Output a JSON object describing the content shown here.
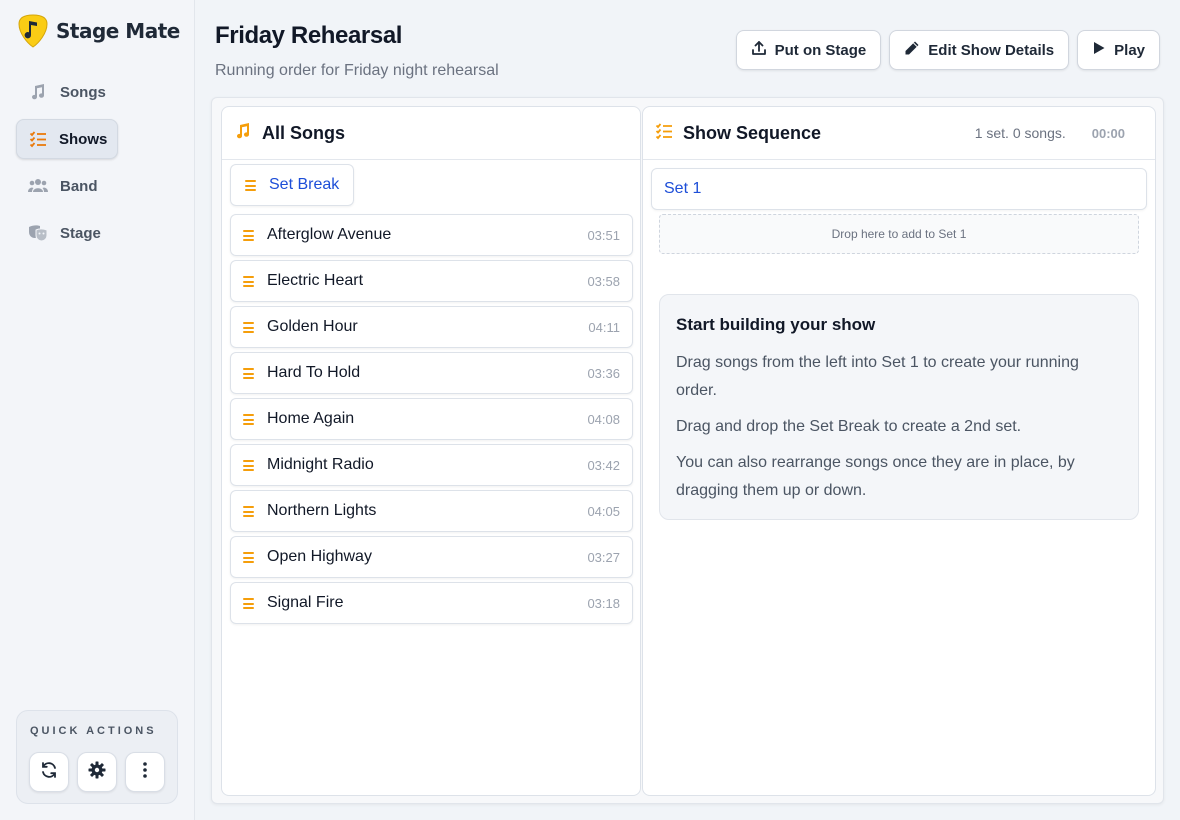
{
  "app": {
    "name": "Stage Mate"
  },
  "sidebar": {
    "items": [
      {
        "label": "Songs",
        "icon": "music-note-icon"
      },
      {
        "label": "Shows",
        "icon": "list-check-icon",
        "active": true
      },
      {
        "label": "Band",
        "icon": "users-icon"
      },
      {
        "label": "Stage",
        "icon": "masks-icon"
      }
    ],
    "quick_actions": {
      "title": "QUICK ACTIONS",
      "buttons": [
        "refresh-icon",
        "gear-icon",
        "more-vertical-icon"
      ]
    }
  },
  "header": {
    "title": "Friday Rehearsal",
    "subtitle": "Running order for Friday night rehearsal",
    "actions": {
      "put_on_stage": "Put on Stage",
      "edit_details": "Edit Show Details",
      "play": "Play"
    }
  },
  "all_songs": {
    "title": "All Songs",
    "set_break_label": "Set Break",
    "songs": [
      {
        "title": "Afterglow Avenue",
        "duration": "03:51"
      },
      {
        "title": "Electric Heart",
        "duration": "03:58"
      },
      {
        "title": "Golden Hour",
        "duration": "04:11"
      },
      {
        "title": "Hard To Hold",
        "duration": "03:36"
      },
      {
        "title": "Home Again",
        "duration": "04:08"
      },
      {
        "title": "Midnight Radio",
        "duration": "03:42"
      },
      {
        "title": "Northern Lights",
        "duration": "04:05"
      },
      {
        "title": "Open Highway",
        "duration": "03:27"
      },
      {
        "title": "Signal Fire",
        "duration": "03:18"
      }
    ]
  },
  "show_sequence": {
    "title": "Show Sequence",
    "summary": "1 set. 0 songs.",
    "total_time": "00:00",
    "set_label": "Set 1",
    "drop_hint": "Drop here to add to Set 1",
    "help": {
      "title": "Start building your show",
      "lines": [
        "Drag songs from the left into Set 1 to create your running order.",
        "Drag and drop the Set Break to create a 2nd set.",
        "You can also rearrange songs once they are in place, by dragging them up or down."
      ]
    }
  },
  "colors": {
    "accent": "#f59e0b",
    "link": "#1d4ed8",
    "logo": "#facc15"
  }
}
